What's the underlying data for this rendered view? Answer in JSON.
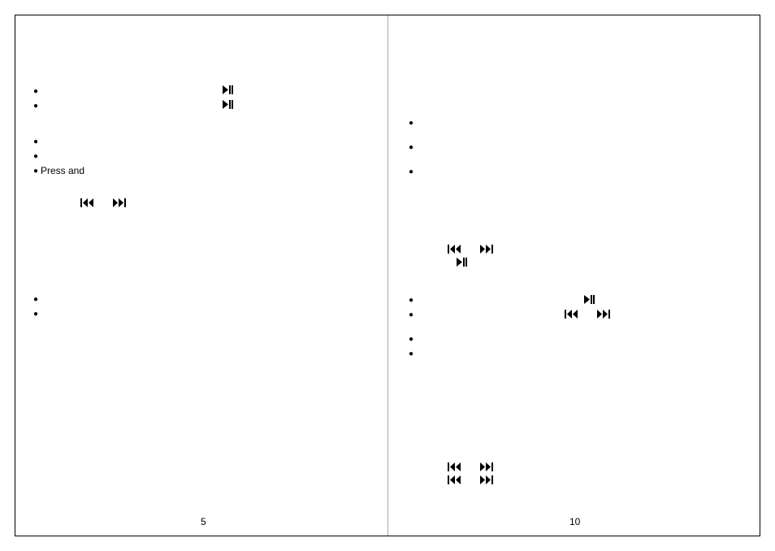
{
  "left_page": {
    "number": "5",
    "text_fragments": {
      "press_and": "Press and"
    }
  },
  "right_page": {
    "number": "10"
  },
  "glyphs": {
    "bullet": "●"
  }
}
